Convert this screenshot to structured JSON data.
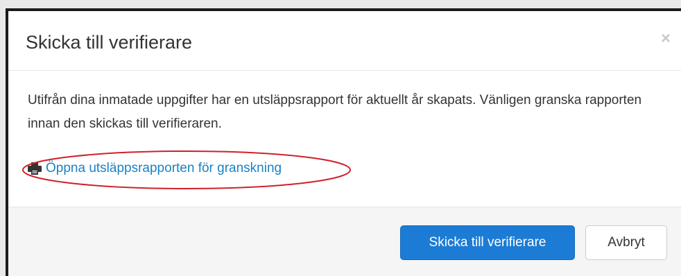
{
  "modal": {
    "title": "Skicka till verifierare",
    "close_symbol": "×",
    "body_text": "Utifrån dina inmatade uppgifter har en utsläppsrapport för aktuellt år skapats. Vänligen granska rapporten innan den skickas till verifieraren.",
    "report_link": {
      "icon": "print-icon",
      "label": "Öppna utsläppsrapporten för granskning"
    },
    "buttons": {
      "submit_label": "Skicka till verifierare",
      "cancel_label": "Avbryt"
    }
  },
  "colors": {
    "primary": "#1c7cd5",
    "link": "#1a82c3",
    "annotation": "#d0202a"
  }
}
